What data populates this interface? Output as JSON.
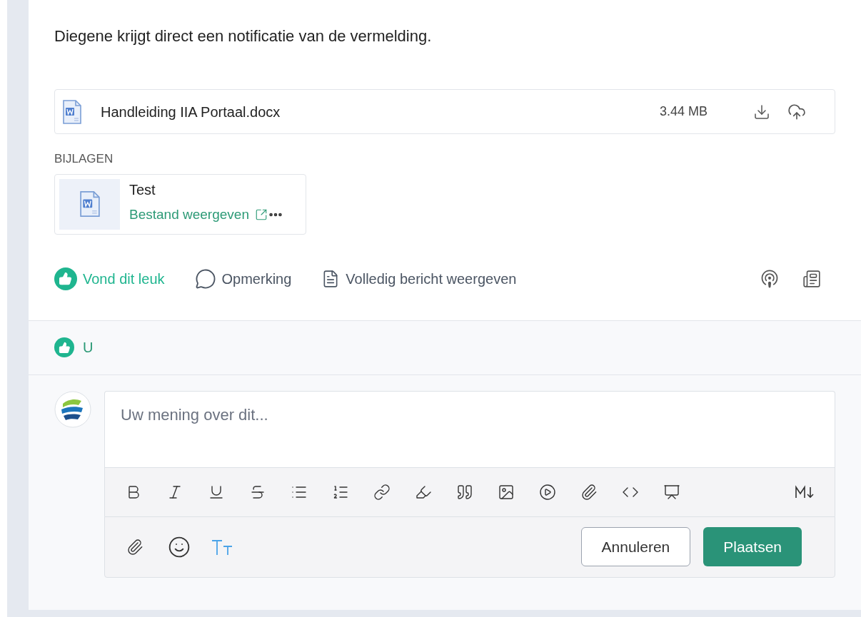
{
  "message": {
    "text": "Diegene krijgt direct een notificatie van de vermelding."
  },
  "file": {
    "name": "Handleiding IIA Portaal.docx",
    "size": "3.44 MB"
  },
  "attachments": {
    "heading": "BIJLAGEN",
    "items": [
      {
        "title": "Test",
        "link": "Bestand weergeven"
      }
    ]
  },
  "actions": [
    {
      "kind": "like",
      "label": "Vond dit leuk",
      "selected": true
    },
    {
      "kind": "comment",
      "label": "Opmerking"
    },
    {
      "kind": "view",
      "label": "Volledig bericht weergeven"
    }
  ],
  "likes": {
    "names": "U"
  },
  "comment_box": {
    "placeholder": "Uw mening over dit...",
    "buttons": [
      {
        "kind": "cancel",
        "label": "Annuleren"
      },
      {
        "kind": "submit",
        "label": "Plaatsen"
      }
    ]
  }
}
